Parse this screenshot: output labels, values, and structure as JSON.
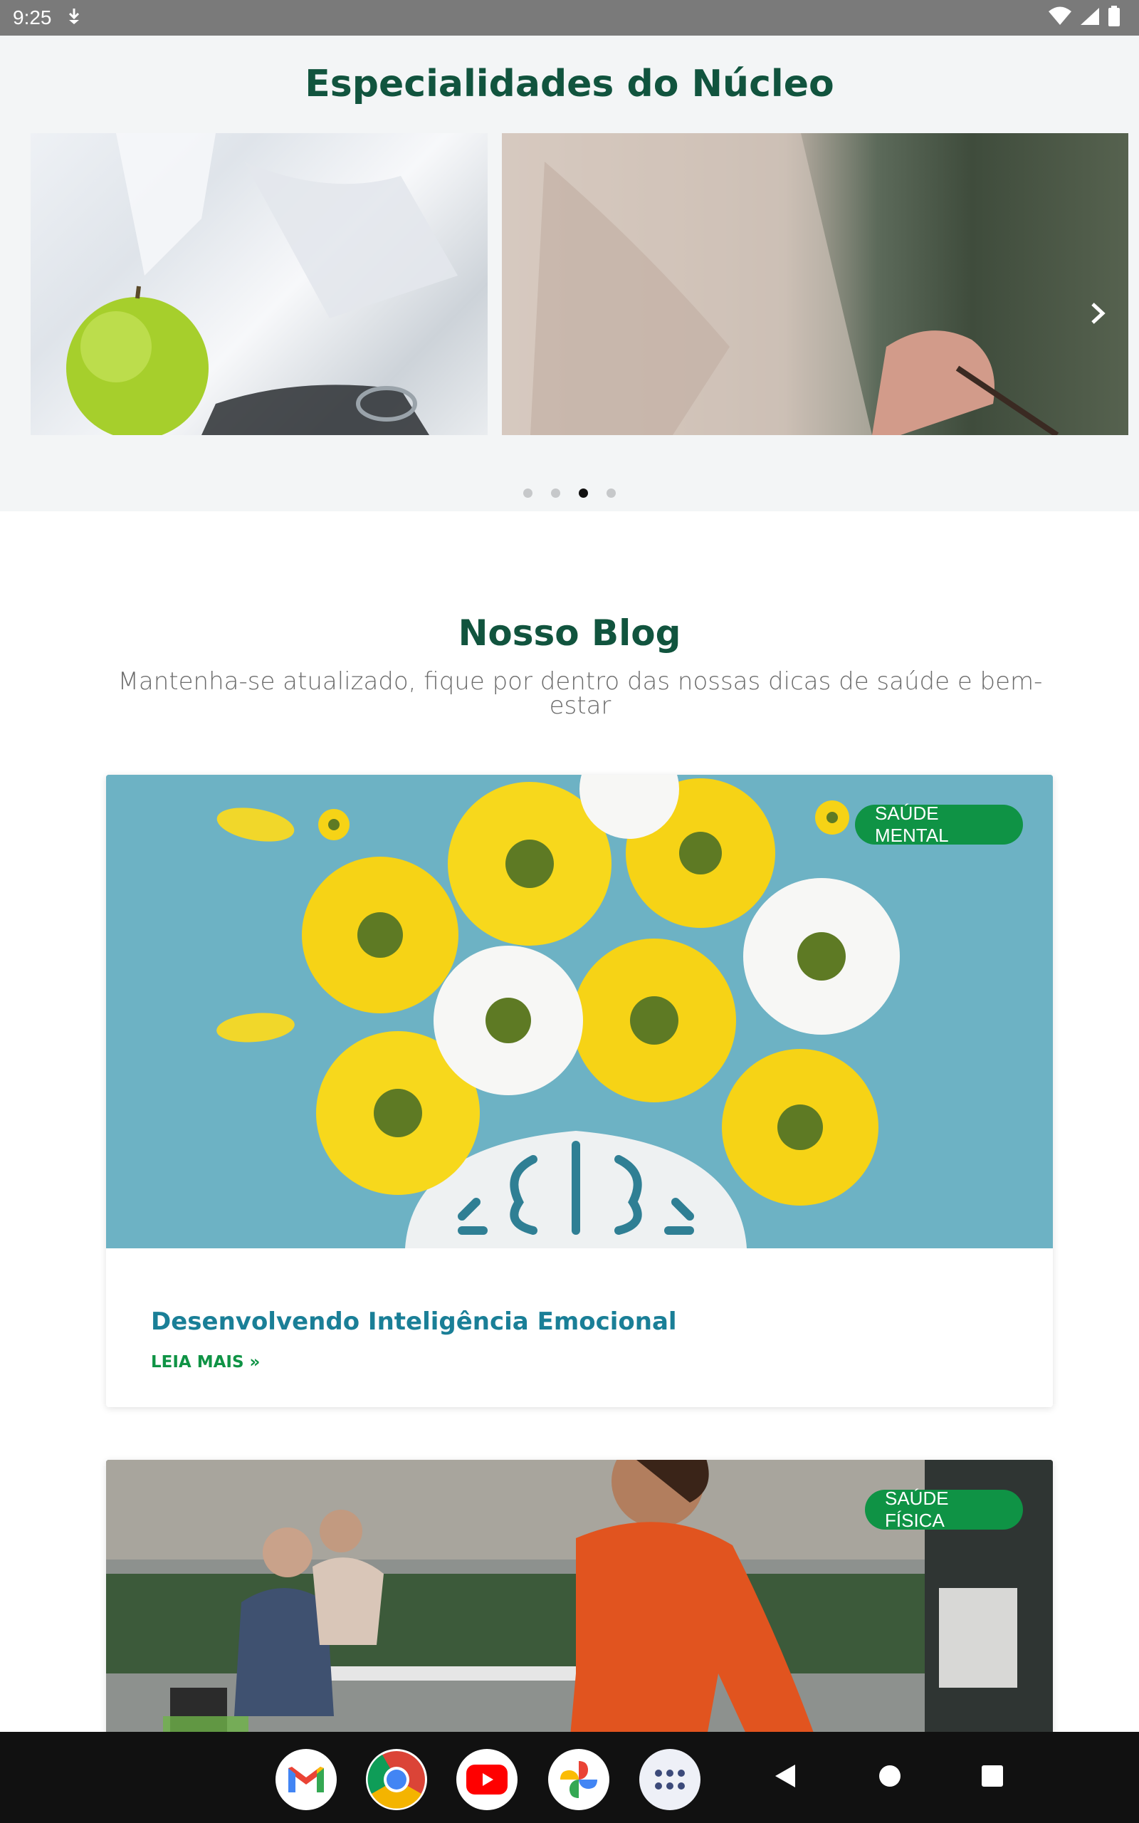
{
  "status": {
    "time": "9:25"
  },
  "specialties": {
    "title": "Especialidades do Núcleo",
    "dots": 4,
    "active_dot": 3
  },
  "blog": {
    "title": "Nosso Blog",
    "subtitle": "Mantenha-se atualizado, fique por dentro das nossas dicas de saúde e bem-estar",
    "posts": [
      {
        "category": "SAÚDE MENTAL",
        "title": "Desenvolvendo Inteligência Emocional",
        "link": "LEIA MAIS »"
      },
      {
        "category": "SAÚDE FÍSICA"
      }
    ]
  },
  "nav": {
    "apps": [
      "gmail-icon",
      "chrome-icon",
      "youtube-icon",
      "photos-icon",
      "app-drawer-icon"
    ]
  },
  "colors": {
    "heading": "#11543e",
    "badge": "#0f9345",
    "post_title": "#1a7f97"
  }
}
